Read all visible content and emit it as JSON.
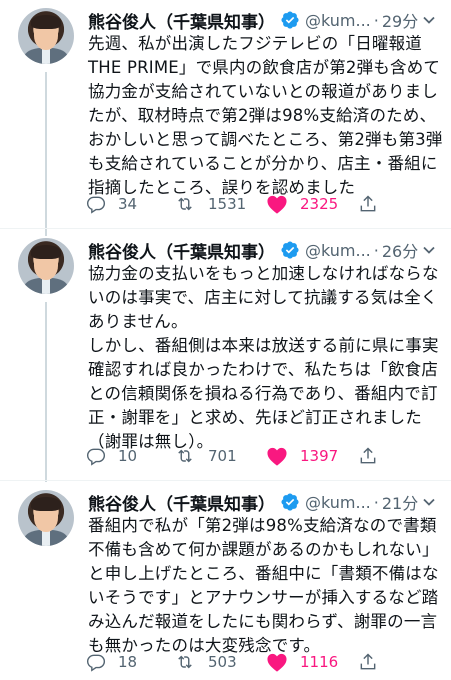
{
  "tweets": [
    {
      "name": "熊谷俊人（千葉県知事）",
      "handle": "@kum...",
      "time": "29分",
      "lines": [
        "先週、私が出演したフジテレビの「日曜報道",
        "THE PRIME」で県内の飲食店が第2弾も含めて",
        "協力金が支給されていないとの報道がありまし",
        "たが、取材時点で第2弾は98%支給済のため、",
        "おかしいと思って調べたところ、第2弾も第3弾",
        "も支給されていることが分かり、店主・番組に",
        "指摘したところ、誤りを認めました"
      ],
      "replies": "34",
      "retweets": "1531",
      "likes": "2325"
    },
    {
      "name": "熊谷俊人（千葉県知事）",
      "handle": "@kum...",
      "time": "26分",
      "lines": [
        "協力金の支払いをもっと加速しなければならな",
        "いのは事実で、店主に対して抗議する気は全く",
        "ありません。",
        "しかし、番組側は本来は放送する前に県に事実",
        "確認すれば良かったわけで、私たちは「飲食店",
        "との信頼関係を損ねる行為であり、番組内で訂",
        "正・謝罪を」と求め、先ほど訂正されました",
        "（謝罪は無し）。"
      ],
      "replies": "10",
      "retweets": "701",
      "likes": "1397"
    },
    {
      "name": "熊谷俊人（千葉県知事）",
      "handle": "@kum...",
      "time": "21分",
      "lines": [
        "番組内で私が「第2弾は98%支給済なので書類",
        "不備も含めて何か課題があるのかもしれない」",
        "と申し上げたところ、番組中に「書類不備はな",
        "いそうです」とアナウンサーが挿入するなど踏",
        "み込んだ報道をしたにも関わらず、謝罪の一言",
        "も無かったのは大変残念です。"
      ],
      "replies": "18",
      "retweets": "503",
      "likes": "1116"
    }
  ],
  "colors": {
    "verified": "#1d9bf0",
    "like": "#f91880",
    "secondary_text": "#536471",
    "thread_line": "#cfd9de"
  },
  "icons": {
    "reply": "speech-bubble",
    "retweet": "retweet-arrows",
    "like": "heart-filled",
    "share": "share-upload",
    "verified": "verified-badge",
    "menu": "chevron-down"
  }
}
